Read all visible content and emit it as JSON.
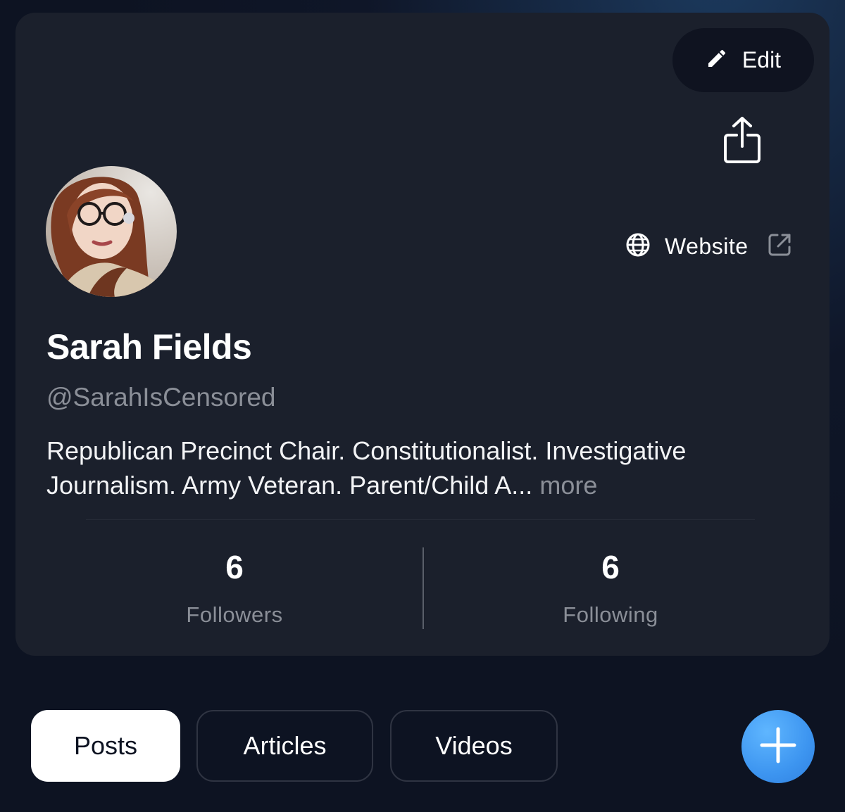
{
  "profile": {
    "edit_label": "Edit",
    "website_label": "Website",
    "name": "Sarah Fields",
    "handle": "@SarahIsCensored",
    "bio": "Republican Precinct Chair. Constitutionalist. Investigative Journalism. Army Veteran. Parent/Child A...",
    "more_label": "more"
  },
  "stats": {
    "followers_count": "6",
    "followers_label": "Followers",
    "following_count": "6",
    "following_label": "Following"
  },
  "tabs": [
    {
      "label": "Posts",
      "active": true
    },
    {
      "label": "Articles",
      "active": false
    },
    {
      "label": "Videos",
      "active": false
    }
  ],
  "icons": {
    "edit": "pencil-icon",
    "share": "share-icon",
    "website": "globe-icon",
    "external": "external-link-icon",
    "fab": "plus-icon"
  },
  "colors": {
    "background": "#0d1322",
    "card": "#1b202c",
    "muted_text": "#8b8f98",
    "accent": "#3d95f0"
  }
}
